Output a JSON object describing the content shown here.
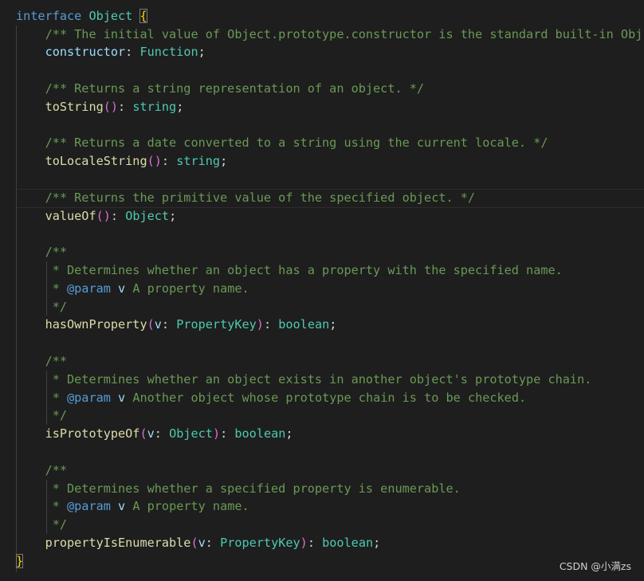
{
  "code": {
    "l1": {
      "kw": "interface",
      "name": "Object",
      "brace": "{"
    },
    "l2": {
      "comment": "/** The initial value of Object.prototype.constructor is the standard built-in Obj"
    },
    "l3": {
      "prop": "constructor",
      "sep": ": ",
      "type": "Function",
      "end": ";"
    },
    "l5": {
      "comment": "/** Returns a string representation of an object. */"
    },
    "l6": {
      "fn": "toString",
      "parens": "()",
      "sep": ": ",
      "type": "string",
      "end": ";"
    },
    "l8": {
      "comment": "/** Returns a date converted to a string using the current locale. */"
    },
    "l9": {
      "fn": "toLocaleString",
      "parens": "()",
      "sep": ": ",
      "type": "string",
      "end": ";"
    },
    "l11": {
      "comment": "/** Returns the primitive value of the specified object. */"
    },
    "l12": {
      "fn": "valueOf",
      "parens": "()",
      "sep": ": ",
      "type": "Object",
      "end": ";"
    },
    "l14": {
      "comment": "/**"
    },
    "l15": {
      "comment": " * Determines whether an object has a property with the specified name."
    },
    "l16": {
      "star": " * ",
      "tag": "@param",
      "param": "v",
      "rest": " A property name."
    },
    "l17": {
      "comment": " */"
    },
    "l18": {
      "fn": "hasOwnProperty",
      "open": "(",
      "param": "v",
      "sep": ": ",
      "type": "PropertyKey",
      "close": ")",
      "sep2": ": ",
      "ret": "boolean",
      "end": ";"
    },
    "l20": {
      "comment": "/**"
    },
    "l21": {
      "comment": " * Determines whether an object exists in another object's prototype chain."
    },
    "l22": {
      "star": " * ",
      "tag": "@param",
      "param": "v",
      "rest": " Another object whose prototype chain is to be checked."
    },
    "l23": {
      "comment": " */"
    },
    "l24": {
      "fn": "isPrototypeOf",
      "open": "(",
      "param": "v",
      "sep": ": ",
      "type": "Object",
      "close": ")",
      "sep2": ": ",
      "ret": "boolean",
      "end": ";"
    },
    "l26": {
      "comment": "/**"
    },
    "l27": {
      "comment": " * Determines whether a specified property is enumerable."
    },
    "l28": {
      "star": " * ",
      "tag": "@param",
      "param": "v",
      "rest": " A property name."
    },
    "l29": {
      "comment": " */"
    },
    "l30": {
      "fn": "propertyIsEnumerable",
      "open": "(",
      "param": "v",
      "sep": ": ",
      "type": "PropertyKey",
      "close": ")",
      "sep2": ": ",
      "ret": "boolean",
      "end": ";"
    },
    "l31": {
      "brace": "}"
    }
  },
  "watermark": "CSDN @小满zs"
}
